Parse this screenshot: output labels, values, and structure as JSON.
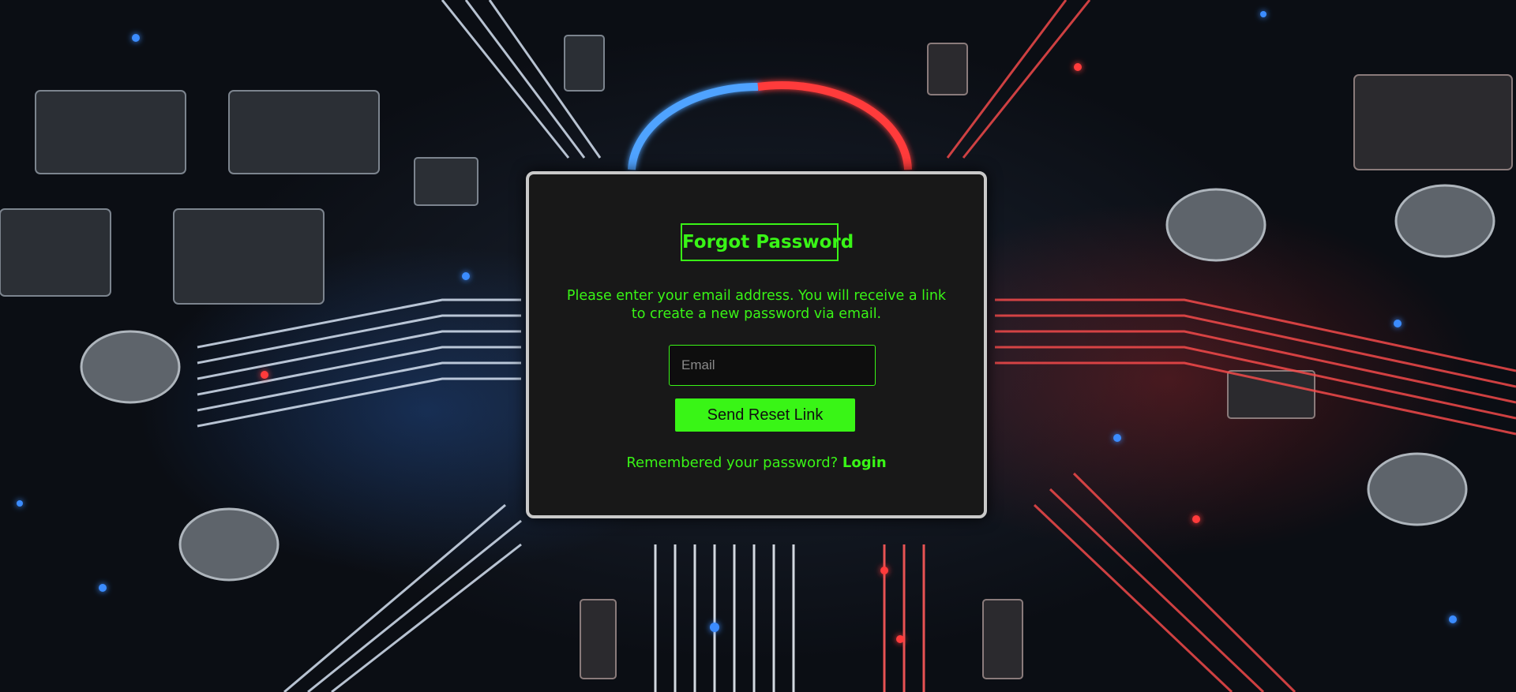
{
  "background": {
    "description_icon": "circuit-board-background",
    "accent_blue": "#2f8cff",
    "accent_red": "#ff2b2b"
  },
  "card": {
    "background_color": "#181818",
    "border_color": "#c9c9c9",
    "accent_color": "#39f516"
  },
  "form": {
    "title": "Forgot Password",
    "description_line1": "Please enter your email address. You will receive a link",
    "description_line2": "to create a new password via email.",
    "email_placeholder": "Email",
    "email_value": "",
    "submit_label": "Send Reset Link",
    "remember_text": "Remembered your password?",
    "login_label": "Login"
  }
}
